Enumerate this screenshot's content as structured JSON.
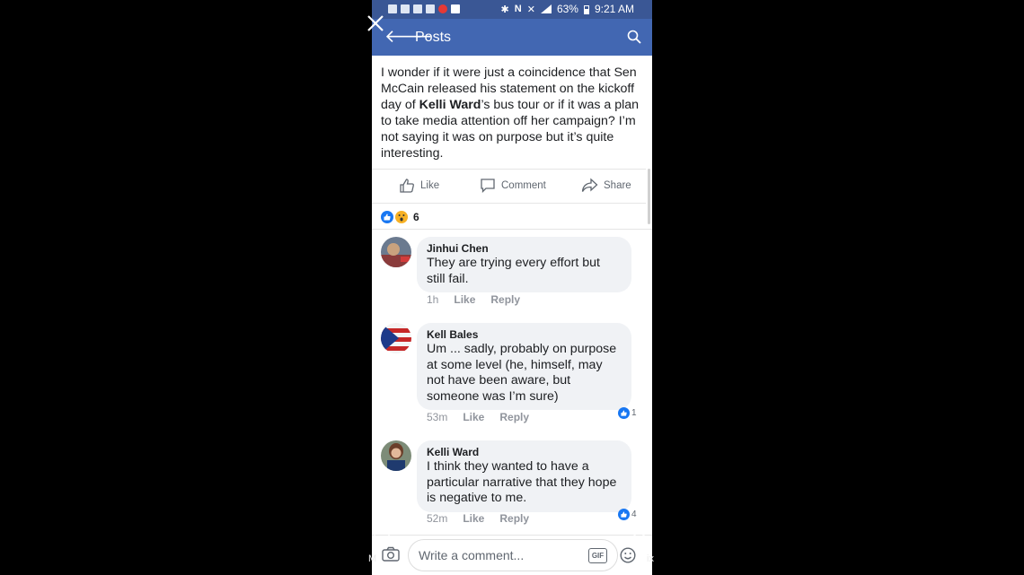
{
  "status_bar": {
    "battery": "63%",
    "time": "9:21 AM"
  },
  "nav": {
    "title": "Posts"
  },
  "post": {
    "text_before": "I wonder if it were just a coincidence that Sen McCain released his statement on the kickoff day of ",
    "bold_name": "Kelli Ward",
    "text_after": "’s bus tour or if it was a plan to take media attention off her campaign? I’m not saying it was on purpose but it’s quite interesting.",
    "actions": {
      "like": "Like",
      "comment": "Comment",
      "share": "Share"
    },
    "reaction_count": "6"
  },
  "comments": [
    {
      "author": "Jinhui Chen",
      "text": "They are trying every effort but still fail.",
      "time": "1h",
      "like_label": "Like",
      "reply_label": "Reply",
      "reactions": ""
    },
    {
      "author": "Kell Bales",
      "text": "Um ... sadly, probably on purpose at some level (he, himself, may not have been aware, but someone was I’m sure)",
      "time": "53m",
      "like_label": "Like",
      "reply_label": "Reply",
      "reactions": "1"
    },
    {
      "author": "Kelli Ward",
      "text": "I think they wanted to have a particular narrative that they hope is negative to me.",
      "time": "52m",
      "like_label": "Like",
      "reply_label": "Reply",
      "reactions": "4"
    }
  ],
  "composer": {
    "placeholder": "Write a comment...",
    "gif_label": "GIF"
  },
  "overlay": {
    "left_label": "M",
    "right_label": "ix"
  },
  "colors": {
    "nav_blue": "#4267b2",
    "status_blue": "#3a5795",
    "like_blue": "#1877f2",
    "bubble_grey": "#f0f2f5"
  }
}
